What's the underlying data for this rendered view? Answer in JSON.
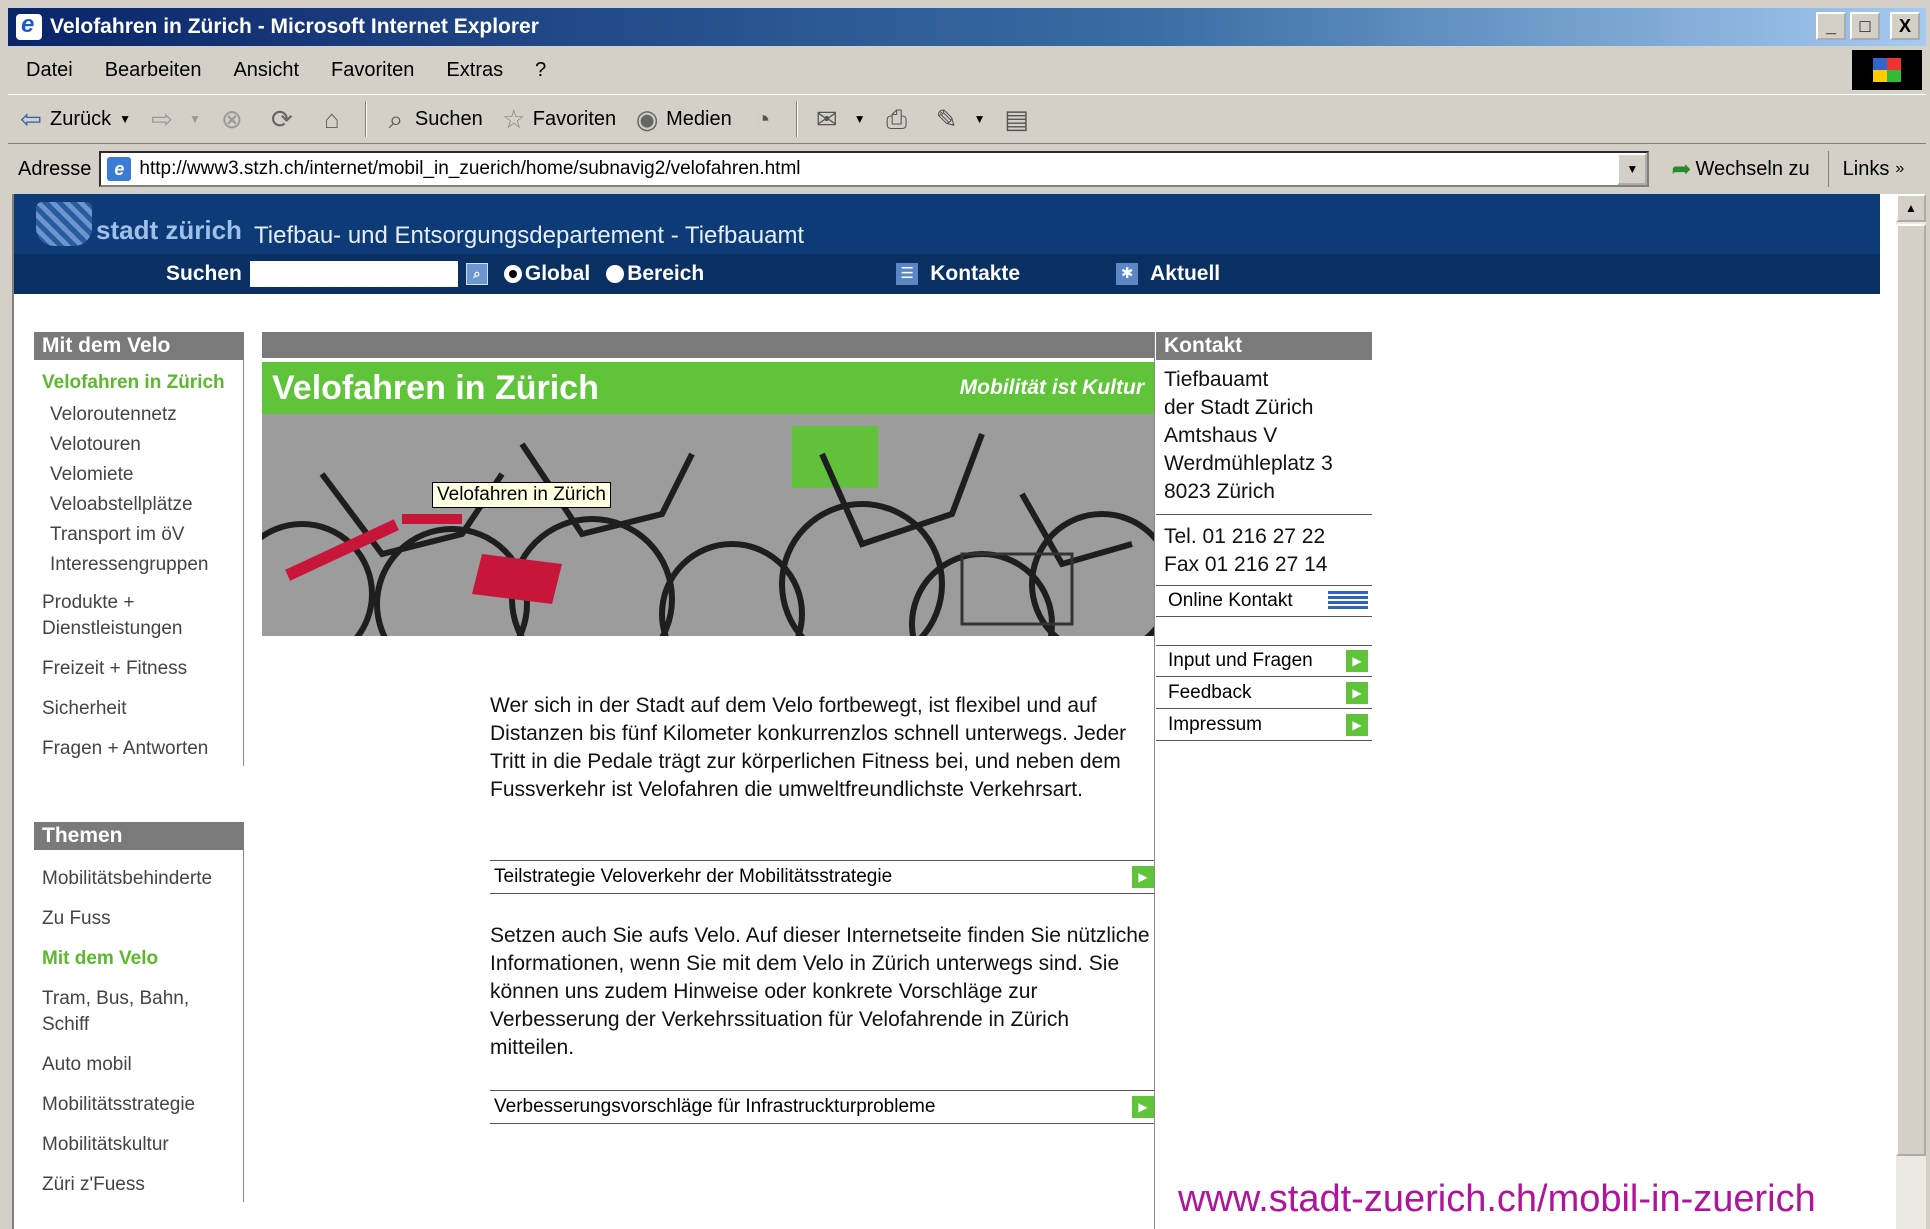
{
  "window": {
    "title": "Velofahren in Zürich - Microsoft Internet Explorer",
    "buttons": [
      "_",
      "□",
      "X"
    ]
  },
  "menu": [
    "Datei",
    "Bearbeiten",
    "Ansicht",
    "Favoriten",
    "Extras",
    "?"
  ],
  "toolbar": {
    "back": "Zurück",
    "search": "Suchen",
    "favorites": "Favoriten",
    "media": "Medien"
  },
  "address": {
    "label": "Adresse",
    "url": "http://www3.stzh.ch/internet/mobil_in_zuerich/home/subnavig2/velofahren.html",
    "goto": "Wechseln zu",
    "links": "Links"
  },
  "site": {
    "logo": "stadt zürich",
    "department": "Tiefbau- und Entsorgungsdepartement - Tiefbauamt",
    "search_label": "Suchen",
    "radio_global": "Global",
    "radio_bereich": "Bereich",
    "kontakte": "Kontakte",
    "aktuell": "Aktuell"
  },
  "leftnav": {
    "section1": "Mit dem Velo",
    "active": "Velofahren in Zürich",
    "sub": [
      "Veloroutennetz",
      "Velotouren",
      "Velomiete",
      "Veloabstellplätze",
      "Transport im öV",
      "Interessengruppen"
    ],
    "items": [
      "Produkte + Dienstleistungen",
      "Freizeit + Fitness",
      "Sicherheit",
      "Fragen + Antworten"
    ],
    "section2": "Themen",
    "themen": [
      "Mobilitätsbehinderte",
      "Zu Fuss",
      "Mit dem Velo",
      "Tram, Bus, Bahn, Schiff",
      "Auto mobil",
      "Mobilitätsstrategie",
      "Mobilitätskultur",
      "Züri z'Fuess"
    ]
  },
  "main": {
    "banner_title": "Velofahren in Zürich",
    "banner_tag": "Mobilität ist Kultur",
    "tooltip": "Velofahren in Zürich",
    "paragraph1": "Wer sich in der Stadt auf dem Velo fortbewegt, ist flexibel und auf Distanzen bis fünf Kilometer konkurrenzlos schnell unterwegs. Jeder Tritt in die Pedale trägt zur körperlichen Fitness bei, und neben dem Fussverkehr ist Velofahren die umweltfreundlichste Verkehrsart.",
    "link1": "Teilstrategie Veloverkehr der Mobilitätsstrategie",
    "paragraph2": "Setzen auch Sie aufs Velo. Auf dieser Internetseite finden Sie nützliche Informationen, wenn Sie mit dem Velo in Zürich unterwegs sind. Sie können uns zudem Hinweise oder konkrete Vorschläge zur Verbesserung der Verkehrssituation für Velofahrende in Zürich mitteilen.",
    "link2": "Verbesserungsvorschläge für Infrastrucktu­rprobleme"
  },
  "contact": {
    "heading": "Kontakt",
    "address_lines": [
      "Tiefbauamt",
      "der Stadt Zürich",
      "Amtshaus V",
      "Werdmühleplatz 3",
      "8023 Zürich"
    ],
    "tel": "Tel. 01 216 27 22",
    "fax": "Fax 01 216 27 14",
    "online": "Online Kontakt",
    "links": [
      "Input und Fragen",
      "Feedback",
      "Impressum"
    ]
  },
  "footer_url": "www.stadt-zuerich.ch/mobil-in-zuerich"
}
